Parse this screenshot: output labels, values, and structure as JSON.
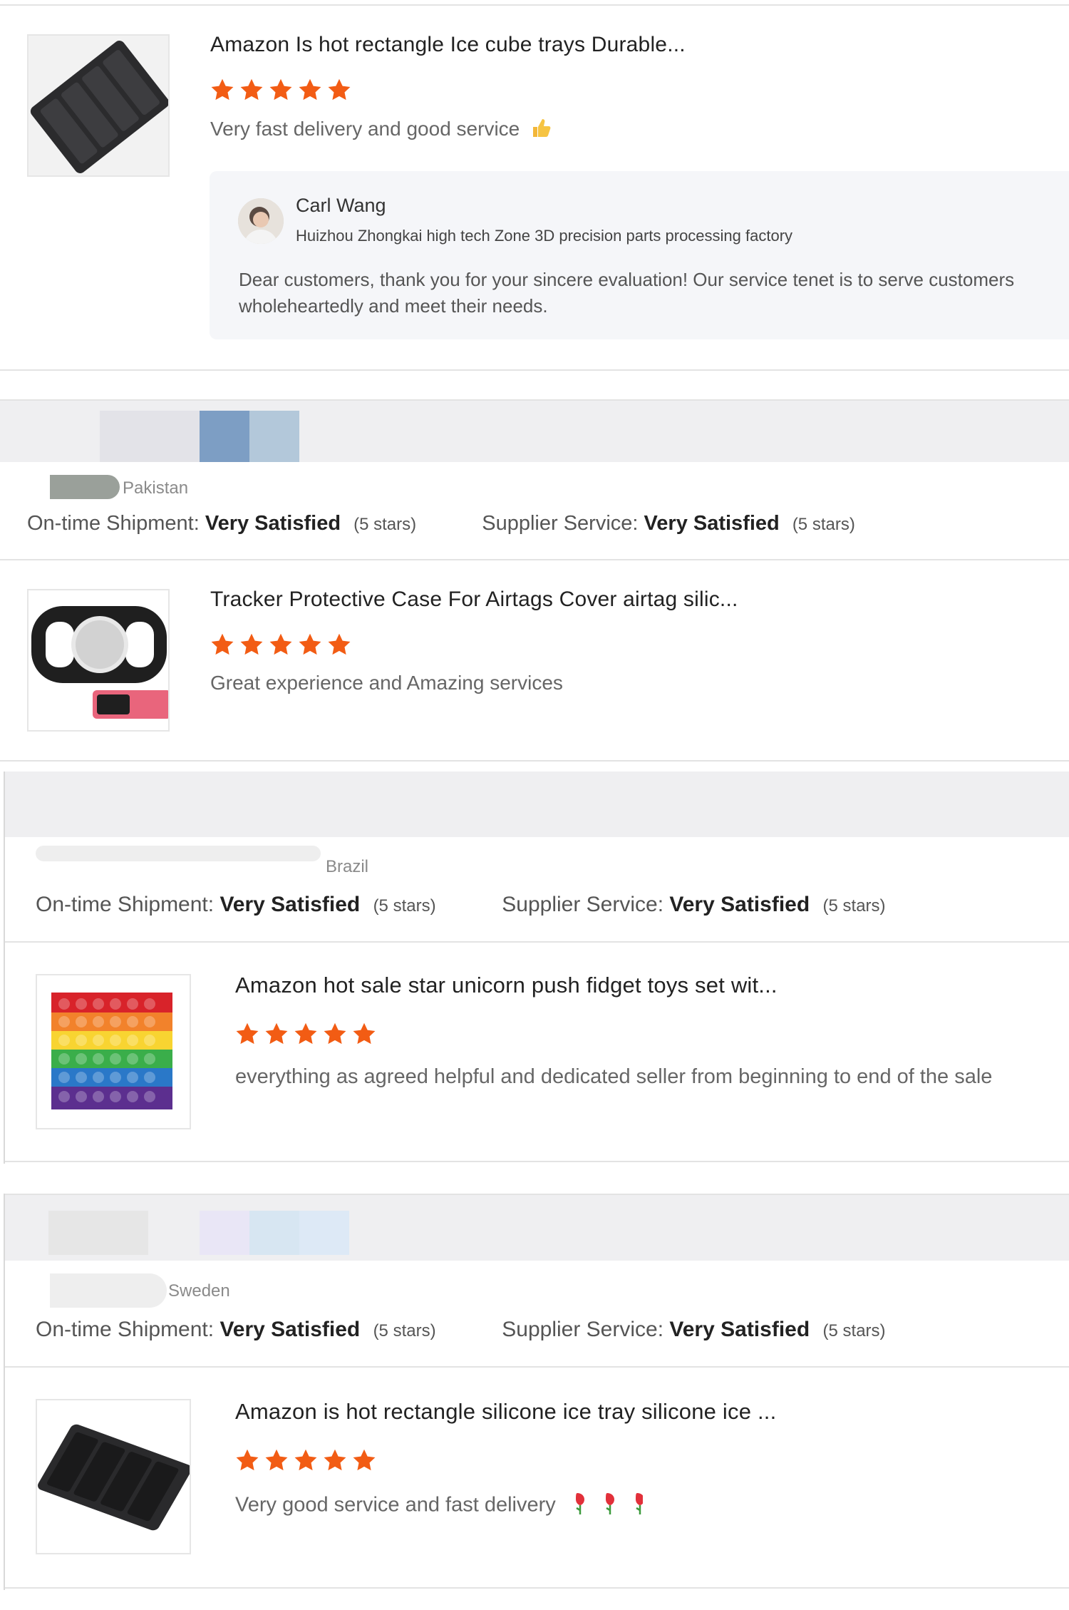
{
  "colors": {
    "star": "#f25c14",
    "band": "#efeff1",
    "reply_bg": "#f5f6f9"
  },
  "ratings_labels": {
    "shipment": "On-time Shipment:",
    "service": "Supplier Service:",
    "value": "Very Satisfied",
    "stars": "(5 stars)"
  },
  "reviews": [
    {
      "product_title": "Amazon Is hot rectangle Ice cube trays Durable...",
      "stars": 5,
      "text": "Very fast delivery and good service",
      "emoji_icon": "thumbs-up-icon",
      "reply": {
        "name": "Carl Wang",
        "company": "Huizhou Zhongkai high tech Zone 3D precision parts processing factory",
        "text": "Dear customers, thank you for your sincere evaluation!  Our service tenet is to serve customers wholeheartedly and meet their needs."
      }
    },
    {
      "country": "Pakistan",
      "product_title": "Tracker Protective Case For Airtags Cover airtag silic...",
      "stars": 5,
      "text": "Great experience and Amazing services"
    },
    {
      "country": "Brazil",
      "product_title": "Amazon hot sale star unicorn push fidget toys set wit...",
      "stars": 5,
      "text": "everything as agreed helpful and dedicated seller from beginning to end of the sale"
    },
    {
      "country": "Sweden",
      "product_title": "Amazon is hot rectangle silicone ice tray silicone ice ...",
      "stars": 5,
      "text": "Very good service and fast delivery",
      "emoji_icon": "rose-icon"
    }
  ]
}
